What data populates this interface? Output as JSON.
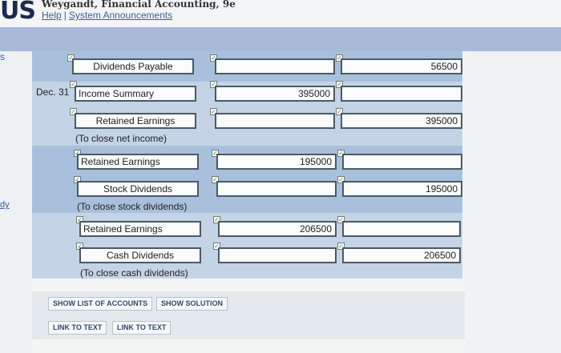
{
  "header": {
    "logo": "US",
    "book_title": "Weygandt, Financial Accounting, 9e",
    "help_link": "Help",
    "separator": "|",
    "announcements_link": "System Announcements"
  },
  "sidebar": {
    "letter": "s",
    "link": "dy"
  },
  "journal": {
    "date": "Dec. 31",
    "rows": [
      {
        "account": "Dividends Payable",
        "debit": "",
        "credit": "56500"
      },
      {
        "account": "Income Summary",
        "debit": "395000",
        "credit": ""
      },
      {
        "account": "Retained Earnings",
        "debit": "",
        "credit": "395000"
      },
      {
        "account": "Retained Earnings",
        "debit": "195000",
        "credit": ""
      },
      {
        "account": "Stock Dividends",
        "debit": "",
        "credit": "195000"
      },
      {
        "account": "Retained Earnings",
        "debit": "206500",
        "credit": ""
      },
      {
        "account": "Cash Dividends",
        "debit": "",
        "credit": "206500"
      }
    ],
    "notes": [
      "(To close net income)",
      "(To close stock dividends)",
      "(To close cash dividends)"
    ],
    "check_mark": "✓"
  },
  "buttons": {
    "show_list": "SHOW LIST OF ACCOUNTS",
    "show_solution": "SHOW SOLUTION",
    "link_text_1": "LINK TO TEXT",
    "link_text_2": "LINK TO TEXT"
  }
}
